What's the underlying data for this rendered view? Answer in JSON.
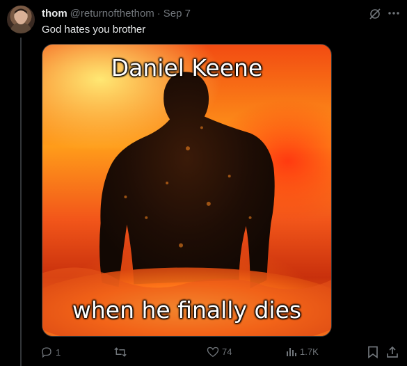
{
  "tweet": {
    "author_name": "thom",
    "handle": "@returnofthethom",
    "separator": "·",
    "date": "Sep 7",
    "text": "God hates you brother"
  },
  "media": {
    "caption_top": "Daniel Keene",
    "caption_bottom": "when he finally dies"
  },
  "actions": {
    "replies": "1",
    "reposts": "",
    "likes": "74",
    "views": "1.7K"
  },
  "icons": [
    "grok-icon",
    "more-icon",
    "reply-icon",
    "repost-icon",
    "like-icon",
    "views-icon",
    "bookmark-icon",
    "share-icon"
  ],
  "colors": {
    "background": "#000000",
    "text": "#e7e9ea",
    "muted": "#71767b"
  }
}
